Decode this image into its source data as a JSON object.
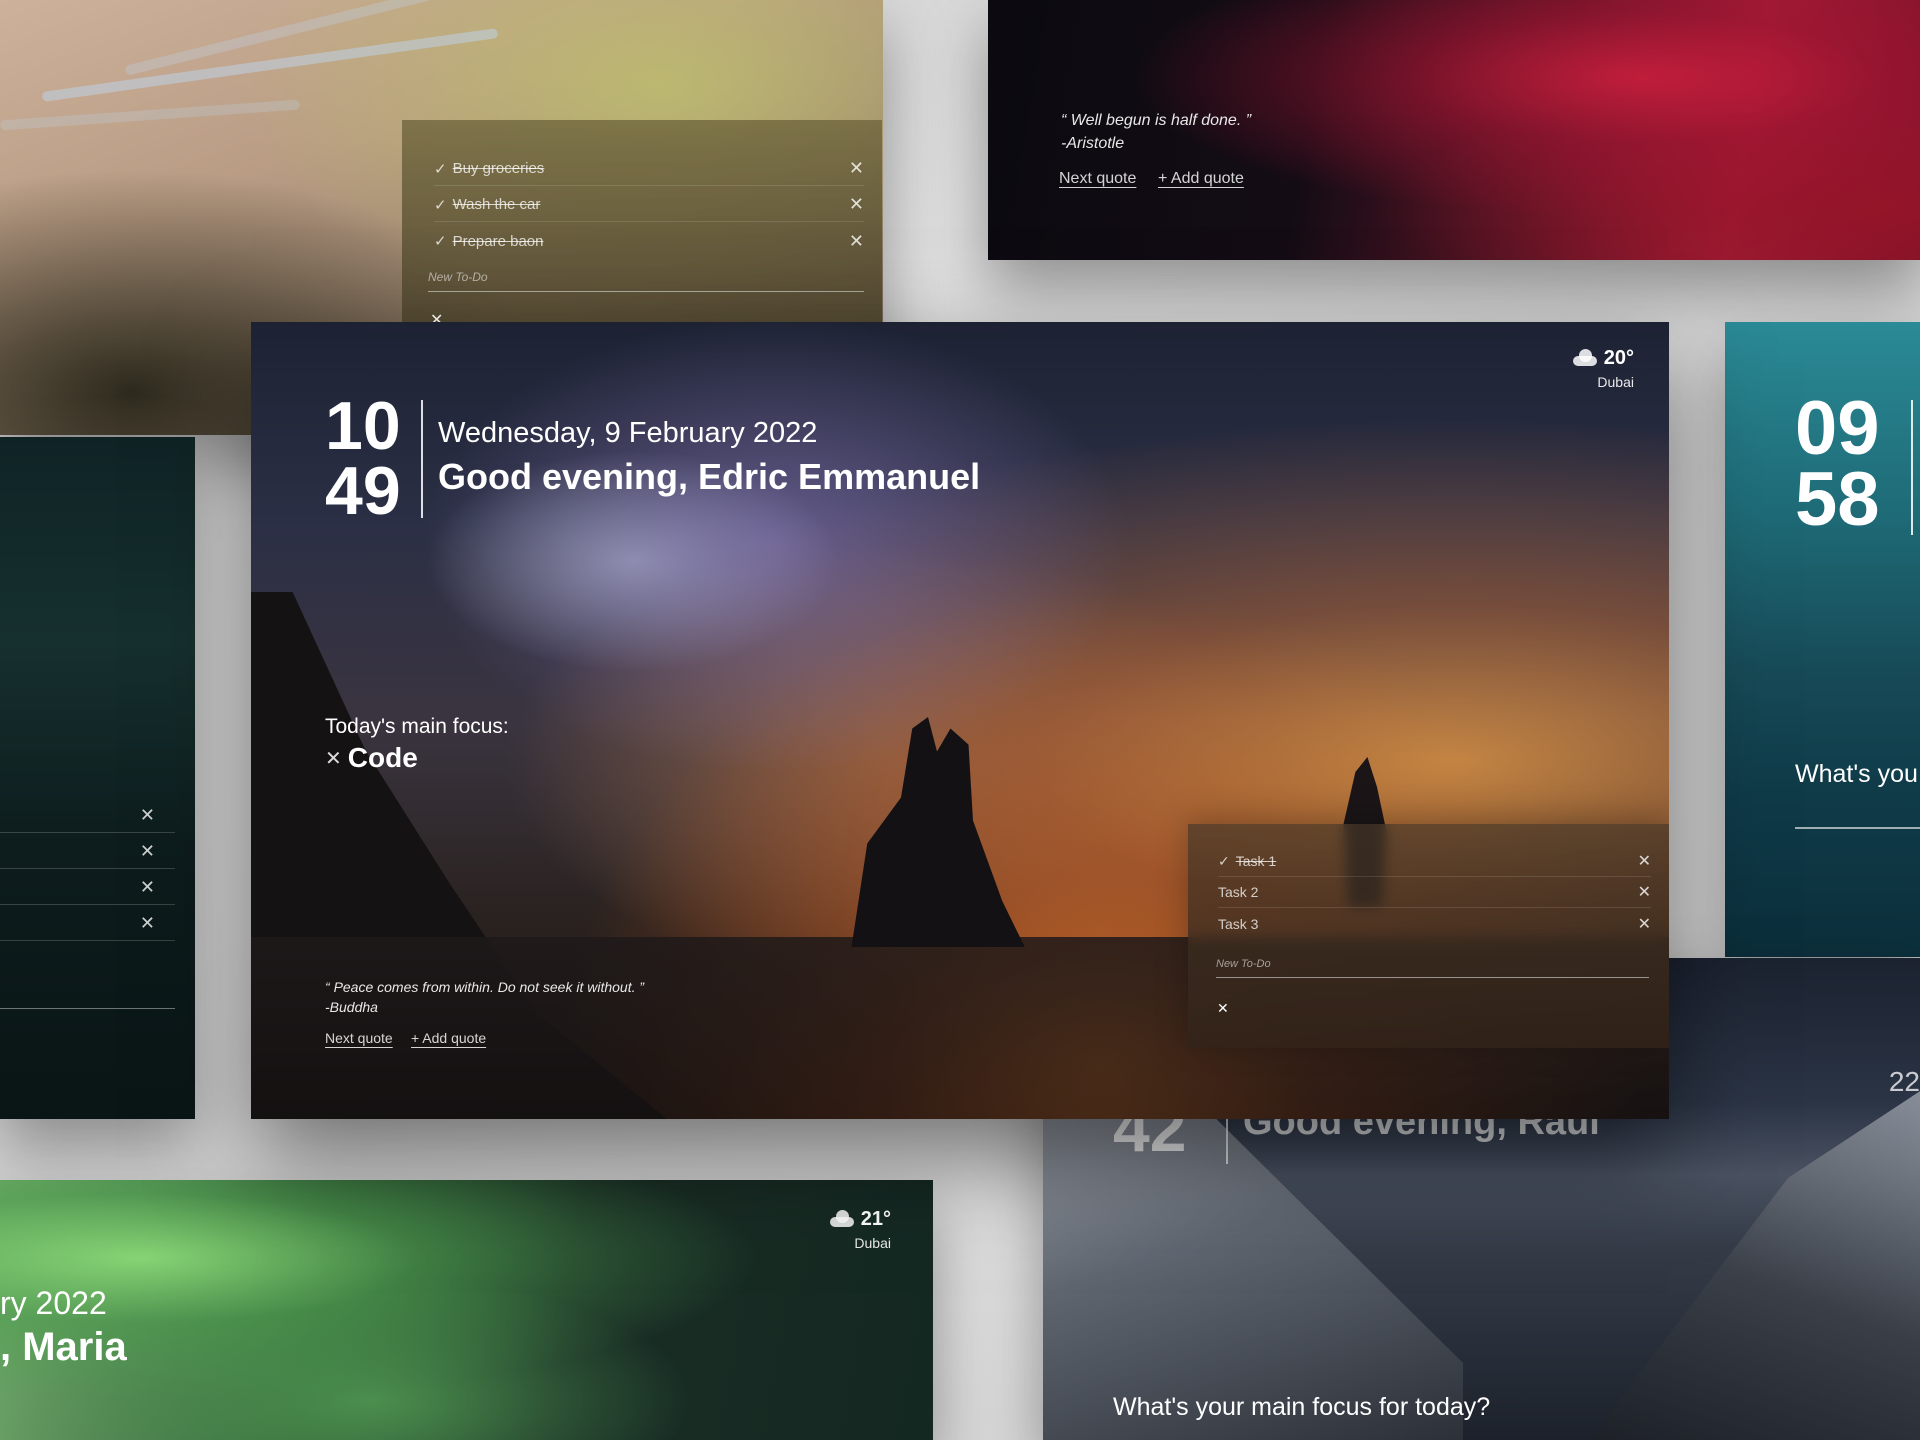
{
  "desert_card": {
    "todos": [
      {
        "label": "Buy groceries",
        "done": true
      },
      {
        "label": "Wash the car",
        "done": true
      },
      {
        "label": "Prepare baon",
        "done": true
      }
    ],
    "new_todo_placeholder": "New To-Do",
    "close_glyph": "✕"
  },
  "canyon_card": {
    "quote_text": "Well begun is half done.",
    "quote_author": "-Aristotle",
    "next_quote": "Next quote",
    "add_quote": "+ Add quote"
  },
  "harbor_card": {
    "hours": "09",
    "minutes": "58",
    "focus_prompt": "What's you"
  },
  "aurora_card": {
    "date_fragment": "ry 2022",
    "greeting_fragment": ", Maria",
    "temp": "21°",
    "city": "Dubai"
  },
  "mountain_card": {
    "minutes": "42",
    "greeting": "Good evening, Raul",
    "date_fragment": "22",
    "focus_prompt": "What's your main focus for today?"
  },
  "main_card": {
    "hours": "10",
    "minutes": "49",
    "date": "Wednesday, 9 February 2022",
    "greeting": "Good evening, Edric Emmanuel",
    "weather": {
      "temp": "20°",
      "city": "Dubai",
      "icon": "cloud-icon"
    },
    "focus_label": "Today's main focus:",
    "focus_value": "Code",
    "quote_text": "Peace comes from within. Do not seek it without.",
    "quote_author": "-Buddha",
    "next_quote": "Next quote",
    "add_quote": "+ Add quote",
    "todos": [
      {
        "label": "Task 1",
        "done": true
      },
      {
        "label": "Task 2",
        "done": false
      },
      {
        "label": "Task 3",
        "done": false
      }
    ],
    "new_todo_placeholder": "New To-Do"
  },
  "glyphs": {
    "check": "✓",
    "close": "✕",
    "quote_open": "“",
    "quote_close": "”"
  }
}
